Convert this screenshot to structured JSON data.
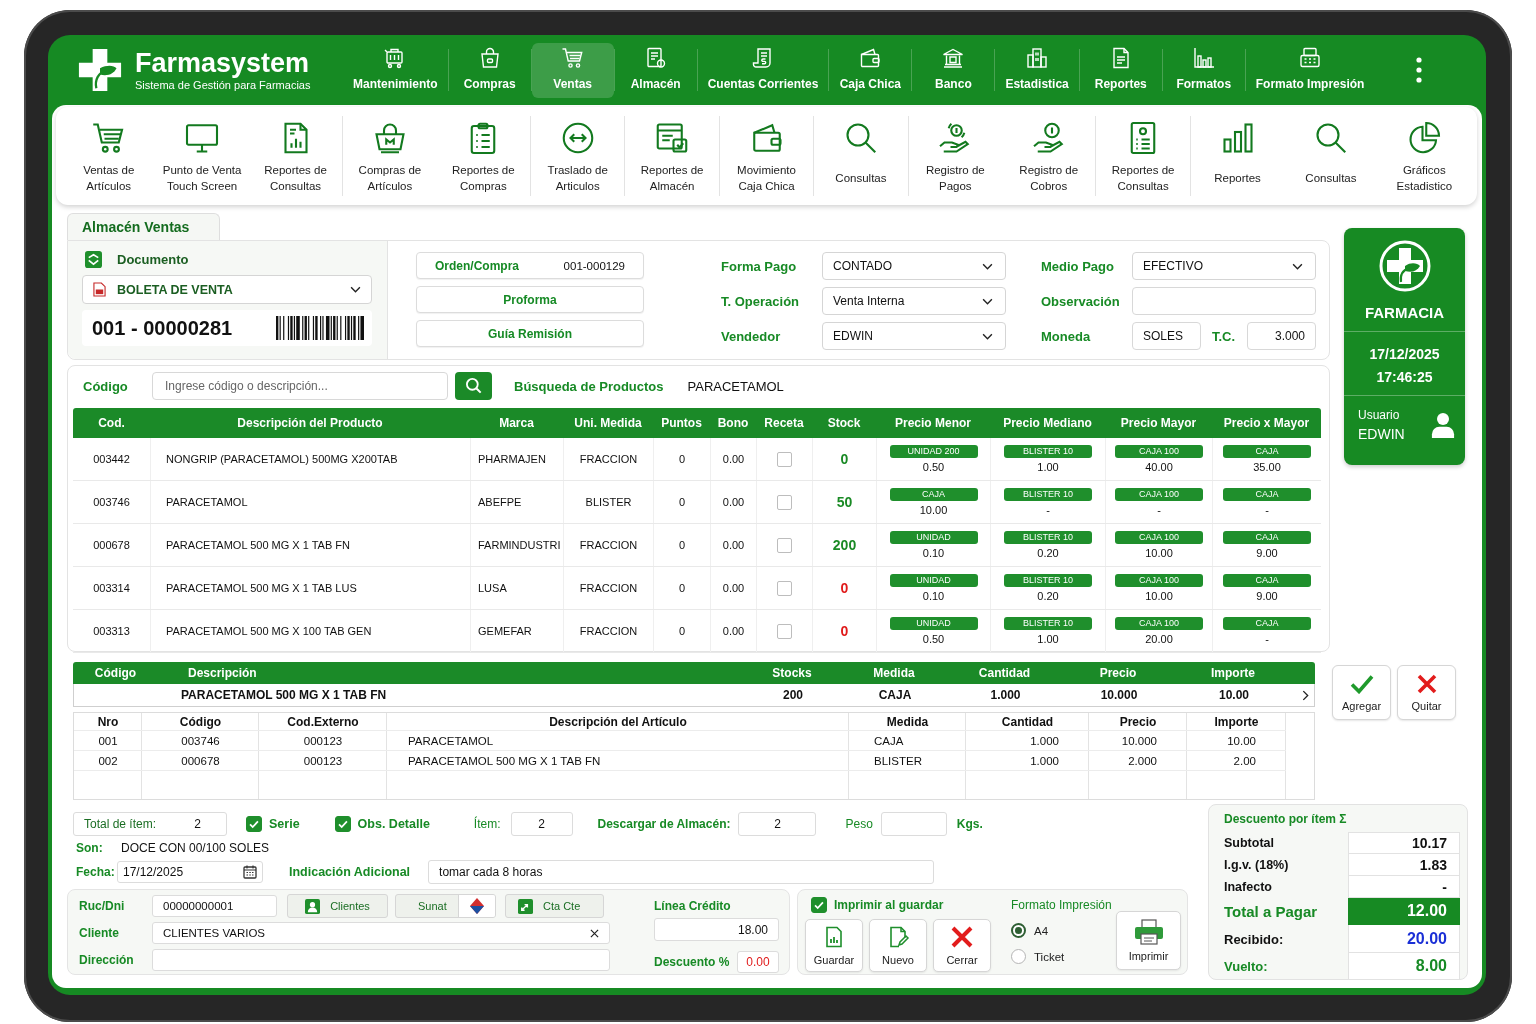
{
  "header": {
    "brand": {
      "name": "Farmasystem",
      "tagline": "Sistema de Gestión para Farmacias"
    },
    "nav": [
      {
        "label": "Mantenimiento",
        "selected": false
      },
      {
        "label": "Compras",
        "selected": false
      },
      {
        "label": "Ventas",
        "selected": true
      },
      {
        "label": "Almacén",
        "selected": false
      },
      {
        "label": "Cuentas Corrientes",
        "selected": false
      },
      {
        "label": "Caja Chica",
        "selected": false
      },
      {
        "label": "Banco",
        "selected": false
      },
      {
        "label": "Estadistica",
        "selected": false
      },
      {
        "label": "Reportes",
        "selected": false
      },
      {
        "label": "Formatos",
        "selected": false
      },
      {
        "label": "Formato Impresión",
        "selected": false
      }
    ]
  },
  "toolbar": {
    "groups": [
      {
        "items": [
          {
            "label": "Ventas de\nArtículos"
          },
          {
            "label": "Punto de Venta\nTouch Screen"
          },
          {
            "label": "Reportes de\nConsultas"
          }
        ]
      },
      {
        "items": [
          {
            "label": "Compras de\nArtículos"
          },
          {
            "label": "Reportes de\nCompras"
          }
        ]
      },
      {
        "items": [
          {
            "label": "Traslado de\nArticulos"
          }
        ]
      },
      {
        "items": [
          {
            "label": "Reportes de\nAlmacén"
          }
        ]
      },
      {
        "items": [
          {
            "label": "Movimiento\nCaja Chica"
          }
        ]
      },
      {
        "items": [
          {
            "label": "Consultas"
          }
        ]
      },
      {
        "items": [
          {
            "label": "Registro de\nPagos"
          },
          {
            "label": "Registro de\nCobros"
          }
        ]
      },
      {
        "items": [
          {
            "label": "Reportes de\nConsultas"
          }
        ]
      },
      {
        "items": [
          {
            "label": "Reportes"
          },
          {
            "label": "Consultas"
          },
          {
            "label": "Gráficos\nEstadistico"
          }
        ]
      }
    ]
  },
  "sale": {
    "tab": "Almacén Ventas",
    "document": {
      "label": "Documento",
      "type": "BOLETA DE VENTA",
      "number": "001 - 00000281"
    },
    "links": [
      {
        "label": "Orden/Compra",
        "value": "001-000129"
      },
      {
        "label": "Proforma"
      },
      {
        "label": "Guía Remisión"
      }
    ],
    "fields": [
      {
        "label": "Forma Pago",
        "kind": "select",
        "value": "CONTADO"
      },
      {
        "label": "Medio Pago",
        "kind": "select",
        "value": "EFECTIVO"
      },
      {
        "label": "T. Operación",
        "kind": "select",
        "value": "Venta Interna"
      },
      {
        "label": "Observación",
        "kind": "text"
      },
      {
        "label": "Vendedor",
        "kind": "select",
        "value": "EDWIN"
      },
      {
        "label": "Moneda",
        "kind": "currency",
        "value": "SOLES",
        "rate_label": "T.C.",
        "rate": "3.000"
      }
    ]
  },
  "user_card": {
    "title": "FARMACIA",
    "date": "17/12/2025",
    "time": "17:46:25",
    "user_label": "Usuario",
    "user_name": "EDWIN"
  },
  "search": {
    "label": "Código",
    "placeholder": "Ingrese código o descripción...",
    "results_label": "Búsqueda de Productos",
    "query": "PARACETAMOL"
  },
  "products": {
    "columns": [
      "Cod.",
      "Descripción del Producto",
      "Marca",
      "Uni. Medida",
      "Puntos",
      "Bono",
      "Receta",
      "Stock",
      "Precio Menor",
      "Precio Mediano",
      "Precio Mayor",
      "Precio x Mayor"
    ],
    "rows": [
      {
        "code": "003442",
        "description": "NONGRIP (PARACETAMOL) 500MG X200TAB",
        "brand": "PHARMAJEN",
        "unit": "FRACCION",
        "points": "0",
        "bonus": "0.00",
        "prescription": false,
        "stock": {
          "value": "0",
          "color": "#1a8a25"
        },
        "prices": [
          {
            "unit": "UNIDAD 200",
            "value": "0.50"
          },
          {
            "unit": "BLISTER 10",
            "value": "1.00"
          },
          {
            "unit": "CAJA 100",
            "value": "40.00"
          },
          {
            "unit": "CAJA",
            "value": "35.00"
          }
        ]
      },
      {
        "code": "003746",
        "description": "PARACETAMOL",
        "brand": "ABEFPE",
        "unit": "BLISTER",
        "points": "0",
        "bonus": "0.00",
        "prescription": false,
        "stock": {
          "value": "50",
          "color": "#1a8a25"
        },
        "prices": [
          {
            "unit": "CAJA",
            "value": "10.00"
          },
          {
            "unit": "BLISTER 10",
            "value": "-"
          },
          {
            "unit": "CAJA 100",
            "value": "-"
          },
          {
            "unit": "CAJA",
            "value": "-"
          }
        ]
      },
      {
        "code": "000678",
        "description": "PARACETAMOL 500 MG X 1 TAB FN",
        "brand": "FARMINDUSTRI",
        "unit": "FRACCION",
        "points": "0",
        "bonus": "0.00",
        "prescription": false,
        "stock": {
          "value": "200",
          "color": "#1a8a25"
        },
        "prices": [
          {
            "unit": "UNIDAD",
            "value": "0.10"
          },
          {
            "unit": "BLISTER 10",
            "value": "0.20"
          },
          {
            "unit": "CAJA 100",
            "value": "10.00"
          },
          {
            "unit": "CAJA",
            "value": "9.00"
          }
        ]
      },
      {
        "code": "003314",
        "description": "PARACETAMOL 500 MG X 1 TAB LUS",
        "brand": "LUSA",
        "unit": "FRACCION",
        "points": "0",
        "bonus": "0.00",
        "prescription": false,
        "stock": {
          "value": "0",
          "color": "#e01b1b"
        },
        "prices": [
          {
            "unit": "UNIDAD",
            "value": "0.10"
          },
          {
            "unit": "BLISTER 10",
            "value": "0.20"
          },
          {
            "unit": "CAJA 100",
            "value": "10.00"
          },
          {
            "unit": "CAJA",
            "value": "9.00"
          }
        ]
      },
      {
        "code": "003313",
        "description": "PARACETAMOL 500 MG X 100 TAB GEN",
        "brand": "GEMEFAR",
        "unit": "FRACCION",
        "points": "0",
        "bonus": "0.00",
        "prescription": false,
        "stock": {
          "value": "0",
          "color": "#e01b1b"
        },
        "prices": [
          {
            "unit": "UNIDAD",
            "value": "0.50"
          },
          {
            "unit": "BLISTER 10",
            "value": "1.00"
          },
          {
            "unit": "CAJA 100",
            "value": "20.00"
          },
          {
            "unit": "CAJA",
            "value": "-"
          }
        ]
      }
    ]
  },
  "entry": {
    "columns": [
      "Código",
      "Descripción",
      "Stocks",
      "Medida",
      "Cantidad",
      "Precio",
      "Importe"
    ],
    "row": {
      "description": "PARACETAMOL 500 MG X 1 TAB FN",
      "stock": "200",
      "unit": "CAJA",
      "quantity": "1.000",
      "price": "10.000",
      "amount": "10.00"
    },
    "buttons": [
      {
        "label": "Agregar",
        "kind": "add"
      },
      {
        "label": "Quitar",
        "kind": "remove"
      }
    ]
  },
  "items": {
    "columns": [
      "Nro",
      "Código",
      "Cod.Externo",
      "Descripción del Artículo",
      "Medida",
      "Cantidad",
      "Precio",
      "Importe"
    ],
    "rows": [
      [
        "001",
        "003746",
        "000123",
        "PARACETAMOL",
        "CAJA",
        "1.000",
        "10.000",
        "10.00"
      ],
      [
        "002",
        "000678",
        "000123",
        "PARACETAMOL 500 MG X 1 TAB FN",
        "BLISTER",
        "1.000",
        "2.000",
        "2.00"
      ]
    ]
  },
  "summary": {
    "total_items": {
      "label": "Total de ítem:",
      "value": "2"
    },
    "options": [
      {
        "label": "Serie",
        "checked": true
      },
      {
        "label": "Obs. Detalle",
        "checked": true
      }
    ],
    "item": {
      "label": "Ítem:",
      "value": "2"
    },
    "warehouse": {
      "label": "Descargar de Almacén:",
      "value": "2"
    },
    "weight": {
      "label": "Peso",
      "unit": "Kgs."
    },
    "amount_words": {
      "label": "Son:",
      "value": "DOCE CON 00/100 SOLES"
    },
    "date": {
      "label": "Fecha:",
      "value": "17/12/2025"
    },
    "note": {
      "label": "Indicación Adicional",
      "value": "tomar cada 8 horas"
    }
  },
  "client": {
    "ruc": {
      "label": "Ruc/Dni",
      "value": "00000000001"
    },
    "buttons": [
      {
        "label": "Clientes"
      },
      {
        "label": "Sunat"
      },
      {
        "label": "Cta Cte"
      }
    ],
    "name": {
      "label": "Cliente",
      "value": "CLIENTES VARIOS"
    },
    "address": {
      "label": "Dirección"
    }
  },
  "credit": {
    "label": "Línea Crédito",
    "value": "18.00"
  },
  "discount": {
    "label": "Descuento %",
    "value": "0.00"
  },
  "print": {
    "option": {
      "label": "Imprimir al guardar",
      "checked": true
    },
    "actions": [
      {
        "label": "Guardar"
      },
      {
        "label": "Nuevo"
      },
      {
        "label": "Cerrar"
      }
    ],
    "format_label": "Formato Impresión",
    "formats": [
      {
        "label": "A4",
        "selected": true
      },
      {
        "label": "Ticket",
        "selected": false
      }
    ],
    "print_button": "Imprimir"
  },
  "totals": {
    "title": "Descuento por ítem Σ",
    "rows": [
      {
        "label": "Subtotal",
        "value": "10.17",
        "kind": "plain"
      },
      {
        "label": "I.g.v. (18%)",
        "value": "1.83",
        "kind": "plain"
      },
      {
        "label": "Inafecto",
        "value": "-",
        "kind": "plain"
      },
      {
        "label": "Total a Pagar",
        "value": "12.00",
        "kind": "total"
      },
      {
        "label": "Recibido:",
        "value": "20.00",
        "kind": "received"
      },
      {
        "label": "Vuelto:",
        "value": "8.00",
        "kind": "change"
      }
    ]
  }
}
